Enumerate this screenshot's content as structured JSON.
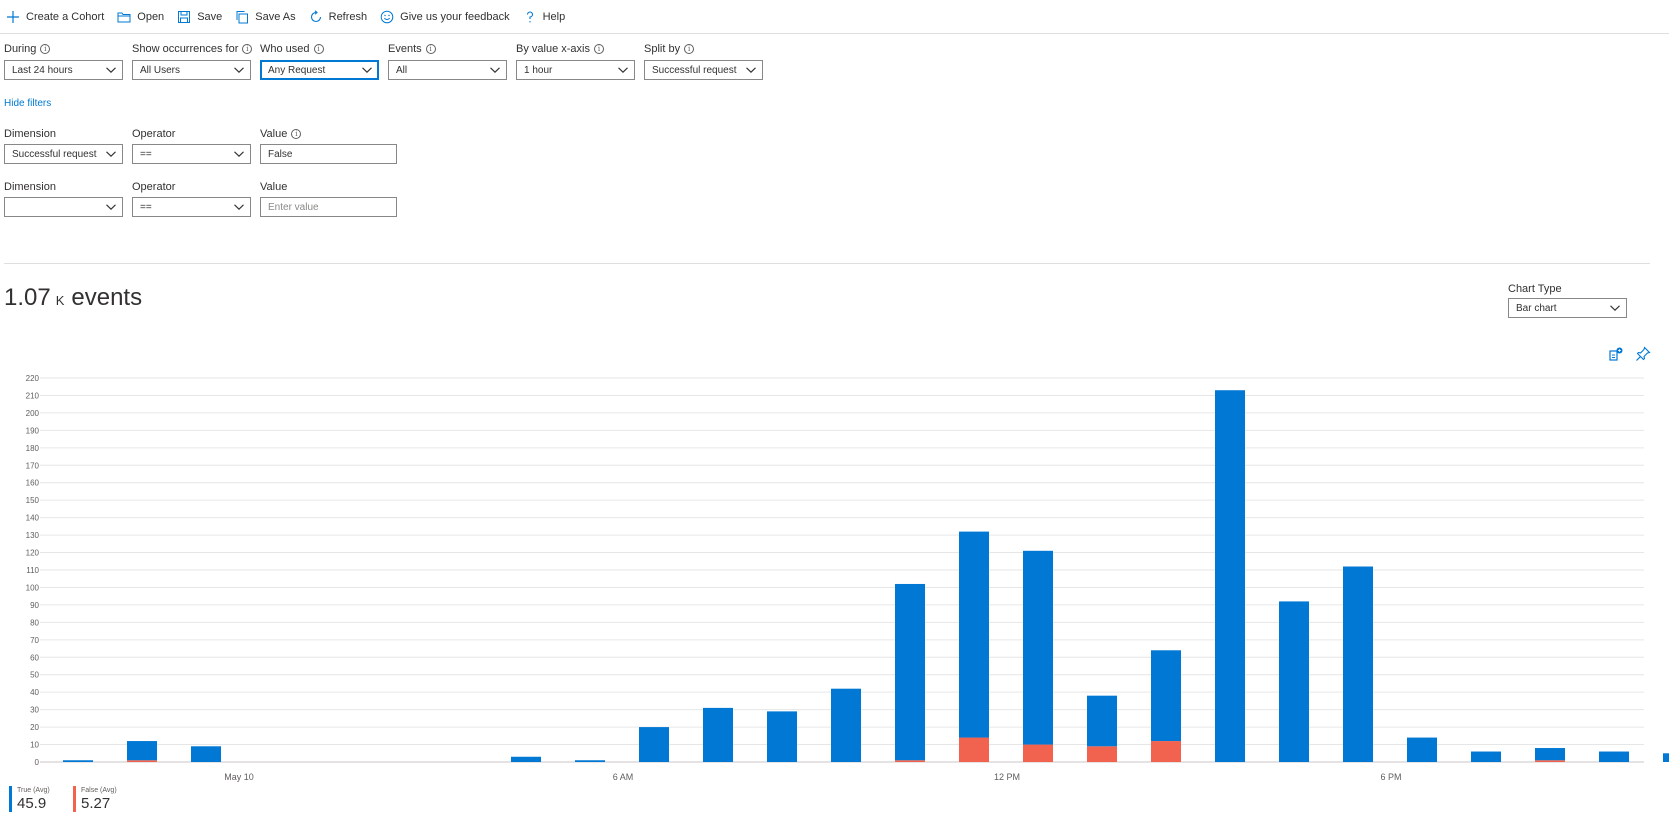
{
  "toolbar": {
    "create_cohort": "Create a Cohort",
    "open": "Open",
    "save": "Save",
    "save_as": "Save As",
    "refresh": "Refresh",
    "feedback": "Give us your feedback",
    "help": "Help"
  },
  "filters": {
    "during": {
      "label": "During",
      "value": "Last 24 hours"
    },
    "show_occurrences": {
      "label": "Show occurrences for",
      "value": "All Users"
    },
    "who_used": {
      "label": "Who used",
      "value": "Any Request"
    },
    "events": {
      "label": "Events",
      "value": "All"
    },
    "by_value": {
      "label": "By value x-axis",
      "value": "1 hour"
    },
    "split_by": {
      "label": "Split by",
      "value": "Successful request"
    },
    "hide_filters": "Hide filters"
  },
  "dimension_rows": [
    {
      "dimension_label": "Dimension",
      "dimension_value": "Successful request",
      "operator_label": "Operator",
      "operator_value": "==",
      "value_label": "Value",
      "value": "False",
      "placeholder": ""
    },
    {
      "dimension_label": "Dimension",
      "dimension_value": "",
      "operator_label": "Operator",
      "operator_value": "==",
      "value_label": "Value",
      "value": "",
      "placeholder": "Enter value"
    }
  ],
  "summary": {
    "value": "1.07",
    "suffix": "K",
    "unit": "events"
  },
  "chart_type": {
    "label": "Chart Type",
    "value": "Bar chart"
  },
  "colors": {
    "true_series": "#0078d4",
    "false_series": "#f1634f",
    "accent": "#0078d4"
  },
  "chart_data": {
    "type": "bar",
    "stacked": true,
    "ylim": [
      0,
      220
    ],
    "yticks": [
      0,
      10,
      20,
      30,
      40,
      50,
      60,
      70,
      80,
      90,
      100,
      110,
      120,
      130,
      140,
      150,
      160,
      170,
      180,
      190,
      200,
      210,
      220
    ],
    "grid": true,
    "x_tick_labels": [
      {
        "slot": 3,
        "label": "May 10"
      },
      {
        "slot": 9,
        "label": "6 AM"
      },
      {
        "slot": 15,
        "label": "12 PM"
      },
      {
        "slot": 21,
        "label": "6 PM"
      }
    ],
    "series": [
      {
        "name": "True (Avg)",
        "color": "#0078d4",
        "values": [
          1,
          11,
          9,
          0,
          0,
          0,
          0,
          3,
          1,
          20,
          31,
          29,
          42,
          101,
          118,
          111,
          29,
          52,
          213,
          92,
          112,
          14,
          6,
          7,
          6,
          5
        ]
      },
      {
        "name": "False (Avg)",
        "color": "#f1634f",
        "values": [
          0,
          1,
          0,
          0,
          0,
          0,
          0,
          0,
          0,
          0,
          0,
          0,
          0,
          1,
          14,
          10,
          9,
          12,
          0,
          0,
          0,
          0,
          0,
          1,
          0,
          0
        ]
      }
    ],
    "legend": [
      {
        "name": "True (Avg)",
        "value": "45.9"
      },
      {
        "name": "False (Avg)",
        "value": "5.27"
      }
    ],
    "legend_position": "bottom-left"
  }
}
